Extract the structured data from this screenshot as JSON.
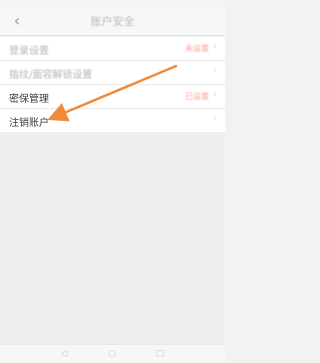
{
  "nav": {
    "back_icon": "chevron-left-icon",
    "title": "账户安全"
  },
  "settings": [
    {
      "label": "登录设置",
      "value": "未设置",
      "blurred": true
    },
    {
      "label": "指纹/面容解锁设置",
      "value": "",
      "blurred": true
    },
    {
      "label": "密保管理",
      "value": "已设置",
      "blurred": false
    },
    {
      "label": "注销账户",
      "value": "",
      "blurred": false
    }
  ],
  "annotation": {
    "arrow_color": "#ee8a3a",
    "target": "注销账户"
  },
  "colors": {
    "accent_value": "#ff9e8e",
    "background": "#f2f2f2"
  }
}
